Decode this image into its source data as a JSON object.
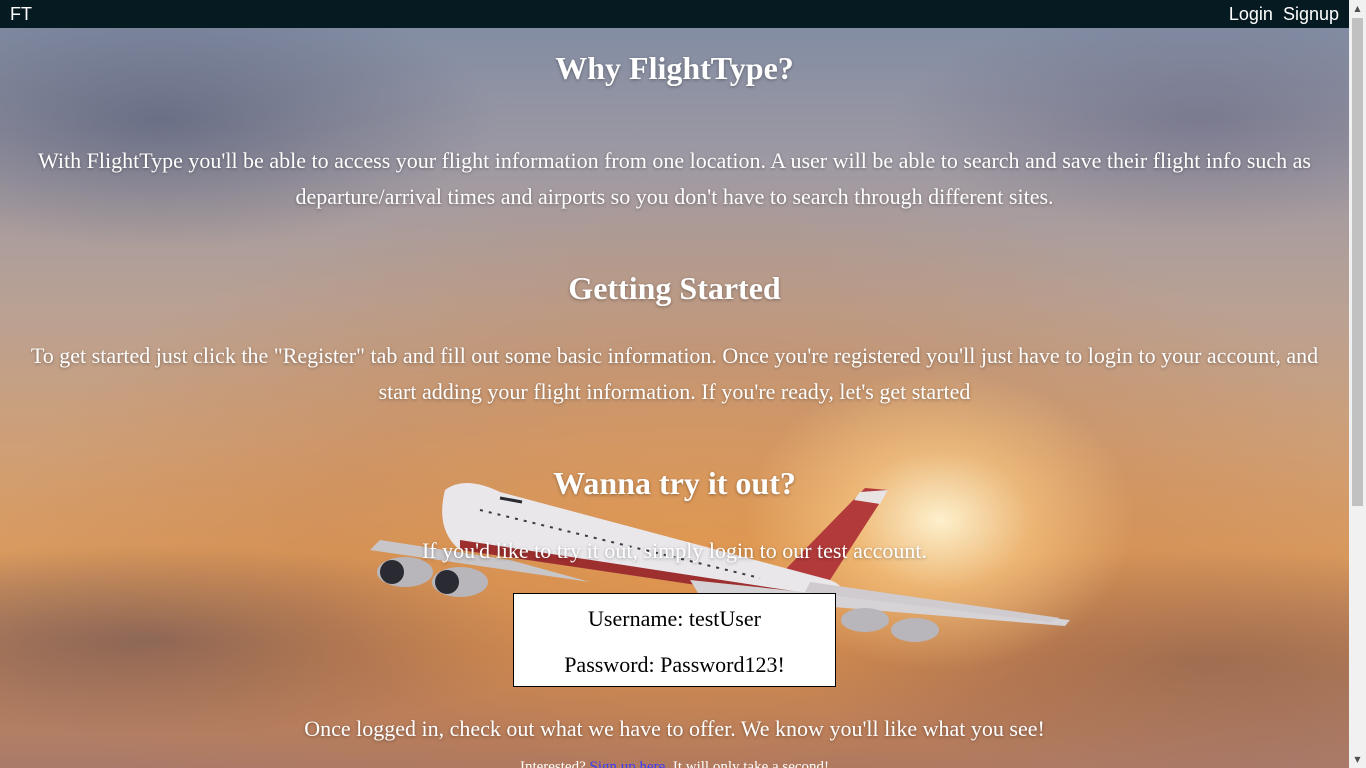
{
  "nav": {
    "brand": "FT",
    "links": [
      "Login",
      "Signup"
    ]
  },
  "sections": {
    "why": {
      "title": "Why FlightType?",
      "text": "With FlightType you'll be able to access your flight information from one location. A user will be able to search and save their flight info such as departure/arrival times and airports so you don't have to search through different sites."
    },
    "started": {
      "title": "Getting Started",
      "text": "To get started just click the \"Register\" tab and fill out some basic information. Once you're registered you'll just have to login to your account, and start adding your flight information. If you're ready, let's get started"
    },
    "try": {
      "title": "Wanna try it out?",
      "text": "If you'd like to try it out, simply login to our test account.",
      "username_line": "Username: testUser",
      "password_line": "Password: Password123!",
      "after_text": "Once logged in, check out what we have to offer. We know you'll like what you see!"
    }
  },
  "bottom": {
    "prefix": "Interested? ",
    "link": "Sign up here",
    "suffix": ". It will only take a second!"
  },
  "colors": {
    "topbar": "#061a22",
    "text": "#ffffff",
    "link": "#3a3aff"
  }
}
